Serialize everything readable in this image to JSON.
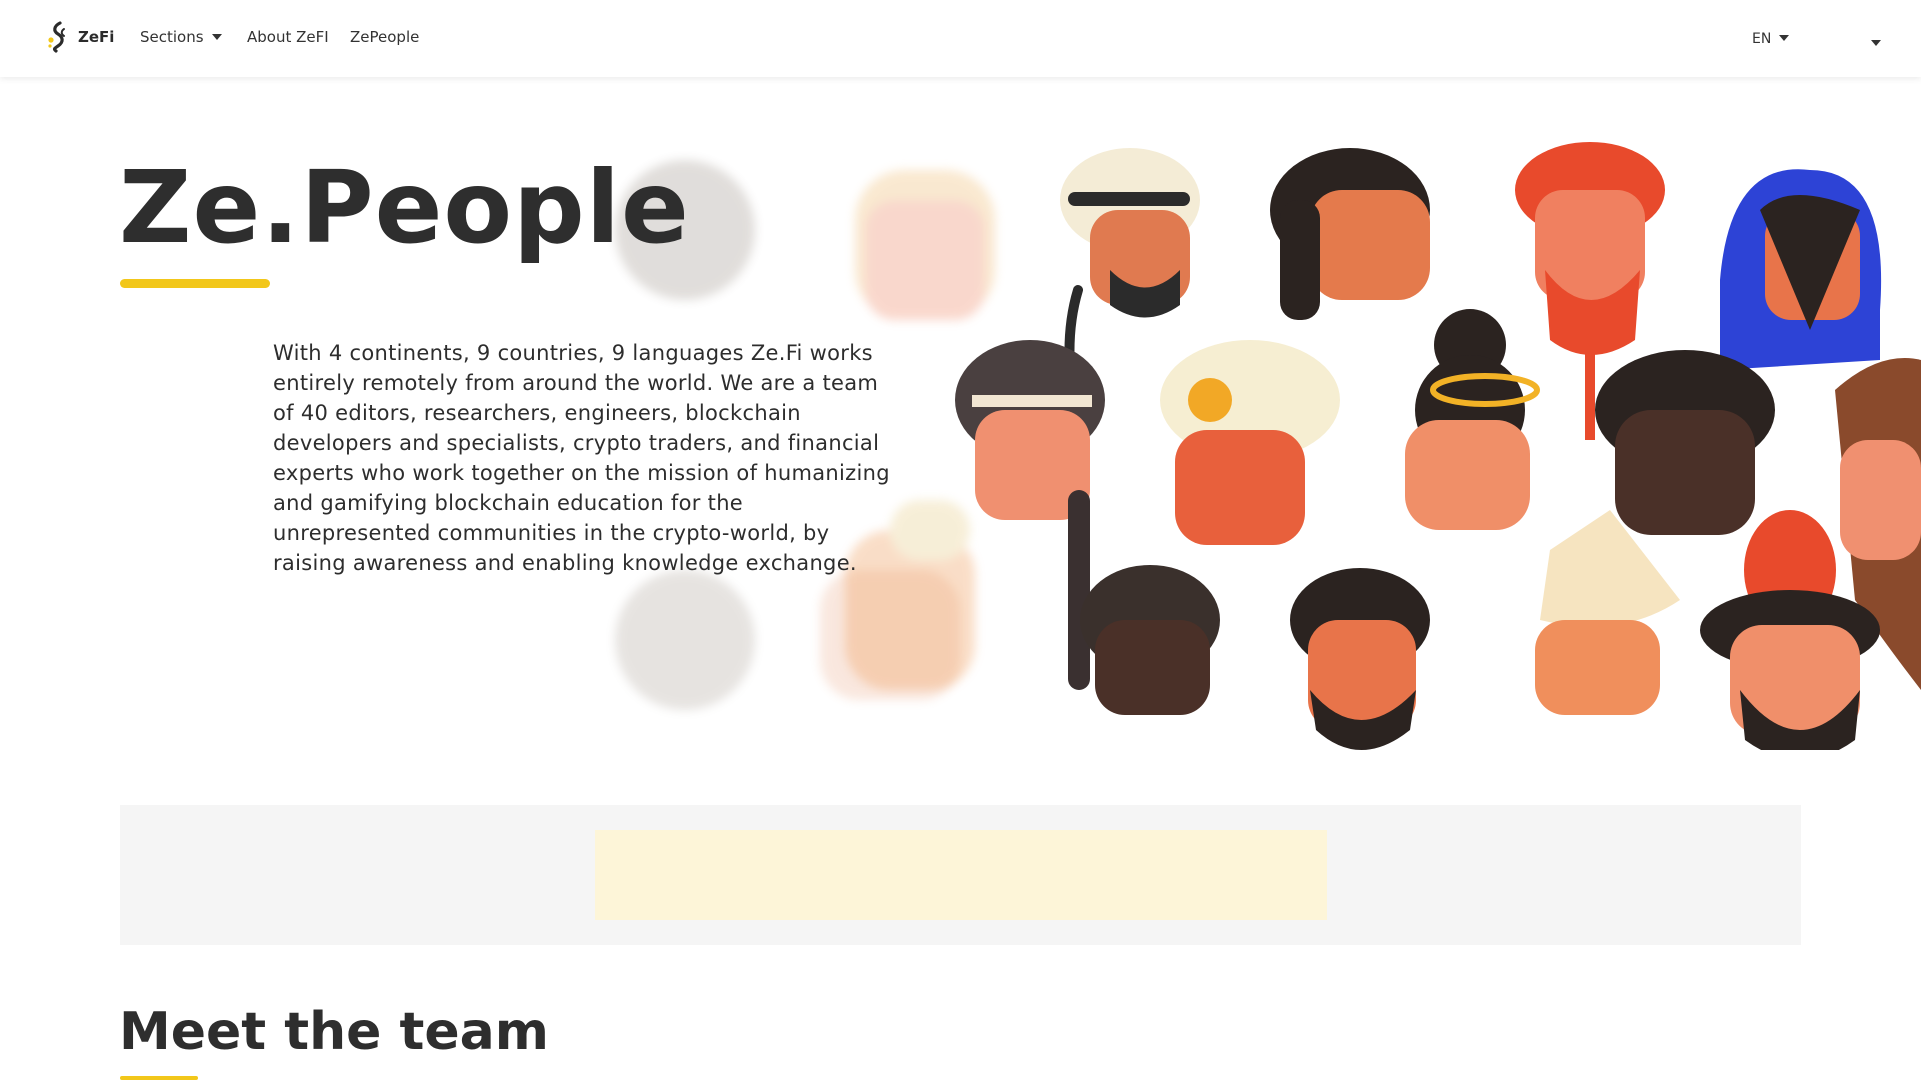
{
  "nav": {
    "brand": "ZeFi",
    "sections_label": "Sections",
    "about_label": "About ZeFI",
    "people_label": "ZePeople",
    "language": "EN"
  },
  "hero": {
    "title": "Ze.People",
    "description": "With 4 continents, 9 countries, 9 languages Ze.Fi works entirely remotely from around the world. We are a team of 40 editors, researchers, engineers, blockchain developers and specialists, crypto traders, and financial experts who work together on the mission of humanizing and gamifying blockchain education for the unrepresented communities in the crypto-world, by raising awareness and enabling knowledge exchange."
  },
  "team": {
    "heading": "Meet the team"
  },
  "colors": {
    "accent": "#f2c71a",
    "text": "#2e2e2e",
    "banner_bg": "#f5f5f5",
    "banner_inner": "#fdf5d8"
  }
}
